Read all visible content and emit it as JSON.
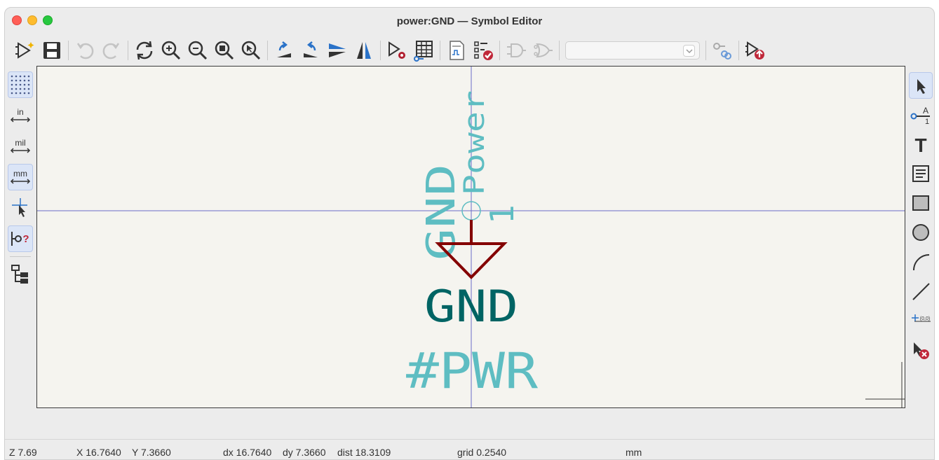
{
  "window": {
    "title": "power:GND — Symbol Editor"
  },
  "toolbar": {
    "buttons": [
      "new-symbol-icon",
      "save-icon",
      "undo-icon",
      "redo-icon",
      "refresh-icon",
      "zoom-in-icon",
      "zoom-out-icon",
      "zoom-fit-icon",
      "zoom-selection-icon",
      "rotate-ccw-icon",
      "rotate-cw-icon",
      "mirror-vertical-icon",
      "mirror-horizontal-icon",
      "symbol-properties-icon",
      "pin-table-icon",
      "datasheet-icon",
      "check-symbol-icon",
      "demorgan-standard-icon",
      "demorgan-alternate-icon",
      "unit-select-combo",
      "show-pin-electrical-type-icon",
      "update-symbol-icon"
    ],
    "unit_select_value": ""
  },
  "left_toolbar": {
    "grid_label": "grid",
    "inches_label": "in",
    "mils_label": "mil",
    "millimeters_label": "mm"
  },
  "right_toolbar": {
    "pin_tool_text_top": "A",
    "pin_tool_text_bottom": "1",
    "text_tool_glyph": "T",
    "anchor_label": "(0,0)"
  },
  "canvas": {
    "value_text": "GND",
    "reference_text": "#PWR",
    "description_text": "Power",
    "pin_name_text": "GND",
    "pin_number_text": "1",
    "colors": {
      "background": "#f5f4ef",
      "body": "#840000",
      "value": "#006464",
      "field": "#5ebdc2",
      "crosshair": "#6b6bc8"
    }
  },
  "status": {
    "zoom": "Z 7.69",
    "x": "X 16.7640",
    "y": "Y 7.3660",
    "dx": "dx 16.7640",
    "dy": "dy 7.3660",
    "dist": "dist 18.3109",
    "grid": "grid 0.2540",
    "units": "mm"
  }
}
